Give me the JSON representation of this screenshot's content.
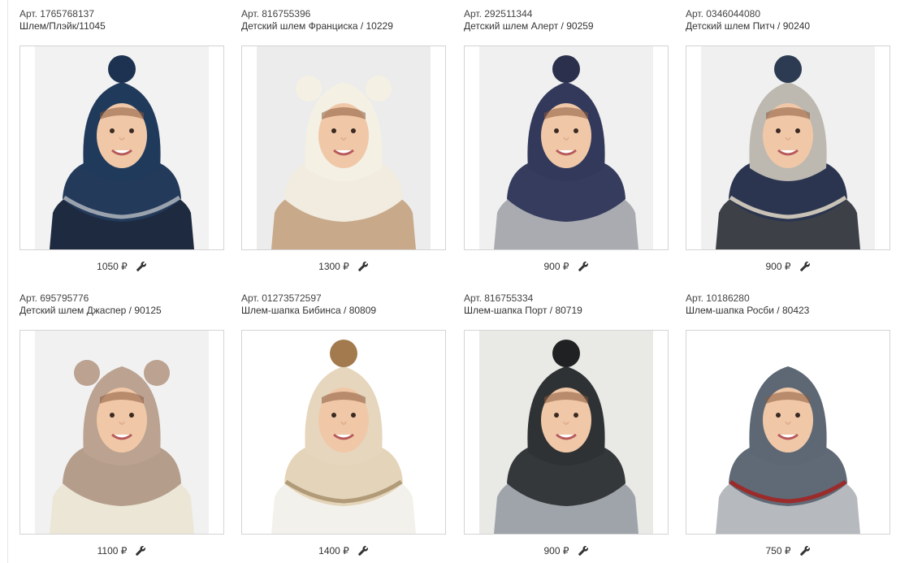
{
  "products": [
    {
      "art": "Арт. 1765768137",
      "name": "Шлем/Плэйк/11045",
      "price": "1050 ₽",
      "bg": "#f2f2f2",
      "hat": "#203a5c",
      "pom": "#1d3250",
      "hasPom": true,
      "ears": false,
      "collar": "#233a5a",
      "stripe": "#9aa3ad",
      "shirt": "#1e2a40",
      "eyes": "open"
    },
    {
      "art": "Арт. 816755396",
      "name": "Детский шлем Франциска / 10229",
      "price": "1300 ₽",
      "bg": "#ececec",
      "hat": "#f4f0e4",
      "pom": "",
      "hasPom": false,
      "ears": true,
      "earColor": "#f4f0e4",
      "collar": "#f1ecdf",
      "stripe": "",
      "shirt": "#c8a98a",
      "eyes": "side"
    },
    {
      "art": "Арт. 292511344",
      "name": "Детский шлем Алерт / 90259",
      "price": "900 ₽",
      "bg": "#f0f0f0",
      "hat": "#33395a",
      "pom": "#2b304d",
      "hasPom": true,
      "ears": false,
      "collar": "#363c5e",
      "stripe": "",
      "shirt": "#a9abb0",
      "eyes": "open"
    },
    {
      "art": "Арт. 0346044080",
      "name": "Детский шлем Питч / 90240",
      "price": "900 ₽",
      "bg": "#f0f0f0",
      "hat": "#bdb8b0",
      "pom": "#2c3a52",
      "hasPom": true,
      "ears": false,
      "collar": "#2b3550",
      "stripe": "#c9c2b6",
      "shirt": "#3d4147",
      "eyes": "open"
    },
    {
      "art": "Арт. 695795776",
      "name": "Детский шлем Джаспер / 90125",
      "price": "1100 ₽",
      "bg": "#f1f1f1",
      "hat": "#bba291",
      "pom": "",
      "hasPom": false,
      "ears": true,
      "earColor": "#bba291",
      "collar": "#b59d8b",
      "stripe": "",
      "shirt": "#ece6d6",
      "eyes": "open"
    },
    {
      "art": "Арт. 01273572597",
      "name": "Шлем-шапка Бибинса / 80809",
      "price": "1400 ₽",
      "bg": "#ffffff",
      "hat": "#e6d6bd",
      "pom": "#a27a4e",
      "hasPom": true,
      "ears": false,
      "collar": "#e4d4b9",
      "stripe": "#b09a78",
      "shirt": "#f3f1ec",
      "eyes": "open"
    },
    {
      "art": "Арт. 816755334",
      "name": "Шлем-шапка Порт / 80719",
      "price": "900 ₽",
      "bg": "#e9e9e6",
      "hat": "#2f3234",
      "pom": "#1f2122",
      "hasPom": true,
      "ears": false,
      "collar": "#35383a",
      "stripe": "",
      "shirt": "#9ea4aa",
      "eyes": "open"
    },
    {
      "art": "Арт. 10186280",
      "name": "Шлем-шапка Росби / 80423",
      "price": "750 ₽",
      "bg": "#ffffff",
      "hat": "#5d6874",
      "pom": "",
      "hasPom": false,
      "ears": false,
      "collar": "#5f6a76",
      "stripe": "#9b2b2b",
      "shirt": "#b6b9bd",
      "eyes": "open"
    }
  ]
}
